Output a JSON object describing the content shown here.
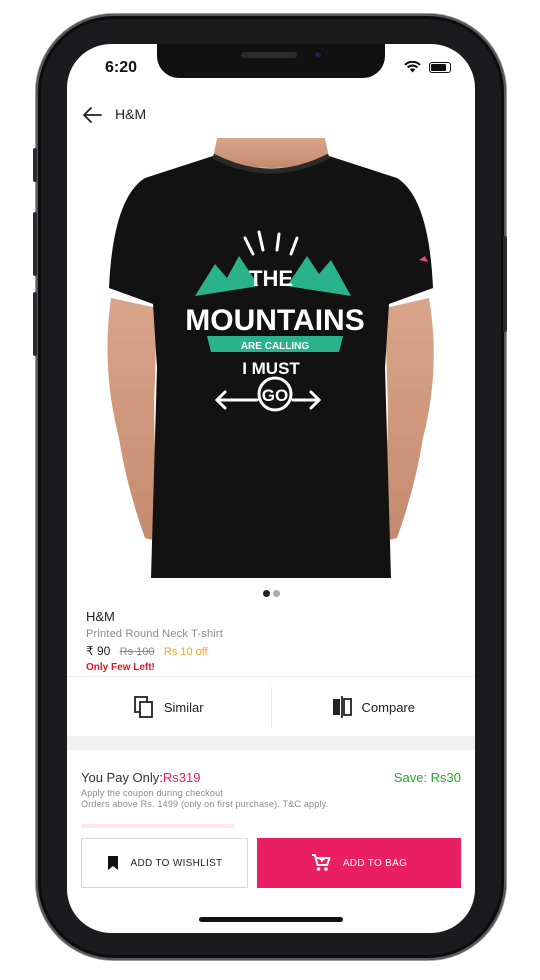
{
  "status_bar": {
    "time": "6:20"
  },
  "header": {
    "title": "H&M"
  },
  "product_image": {
    "slogan_lines": [
      "THE",
      "MOUNTAINS",
      "ARE CALLING",
      "I MUST",
      "GO"
    ],
    "shirt_color": "#121212",
    "accent_color": "#2ab38b"
  },
  "carousel": {
    "pages": 2,
    "active": 1
  },
  "product": {
    "brand": "H&M",
    "name": "Printed Round Neck T-shirt",
    "price": "₹ 90",
    "mrp": "Rs 100",
    "discount": "Rs 10 off",
    "stock_note": "Only Few Left!"
  },
  "actions": {
    "similar": "Similar",
    "compare": "Compare"
  },
  "payment": {
    "label": "You Pay Only:",
    "amount": "Rs319",
    "save": "Save: Rs30",
    "note1": "Apply the coupon during checkout",
    "note2": "Orders above Rs. 1499 (only on first purchase). T&C apply."
  },
  "buttons": {
    "wishlist": "ADD TO WISHLIST",
    "bag": "ADD TO BAG"
  },
  "colors": {
    "accent": "#e91e63",
    "save_green": "#2ba52e",
    "discount_orange": "#f5a623",
    "stock_red": "#e0181f"
  }
}
